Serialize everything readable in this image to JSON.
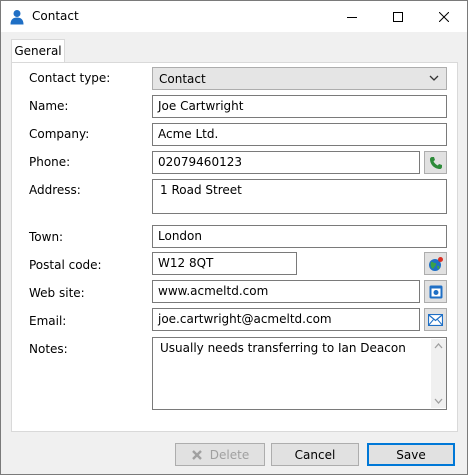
{
  "window": {
    "title": "Contact"
  },
  "tabs": [
    {
      "label": "General"
    }
  ],
  "form": {
    "contact_type": {
      "label": "Contact type:",
      "value": "Contact"
    },
    "name": {
      "label": "Name:",
      "value": "Joe Cartwright"
    },
    "company": {
      "label": "Company:",
      "value": "Acme Ltd."
    },
    "phone": {
      "label": "Phone:",
      "value": "02079460123"
    },
    "address": {
      "label": "Address:",
      "value": "1 Road Street"
    },
    "town": {
      "label": "Town:",
      "value": "London"
    },
    "postal_code": {
      "label": "Postal code:",
      "value": "W12 8QT"
    },
    "web_site": {
      "label": "Web site:",
      "value": "www.acmeltd.com"
    },
    "email": {
      "label": "Email:",
      "value": "joe.cartwright@acmeltd.com"
    },
    "notes": {
      "label": "Notes:",
      "value": "Usually needs transferring to Ian Deacon"
    }
  },
  "buttons": {
    "delete": "Delete",
    "cancel": "Cancel",
    "save": "Save"
  },
  "colors": {
    "accent": "#0078d7",
    "phone_icon": "#2e8b3a",
    "mail_icon": "#1f6fc5"
  }
}
